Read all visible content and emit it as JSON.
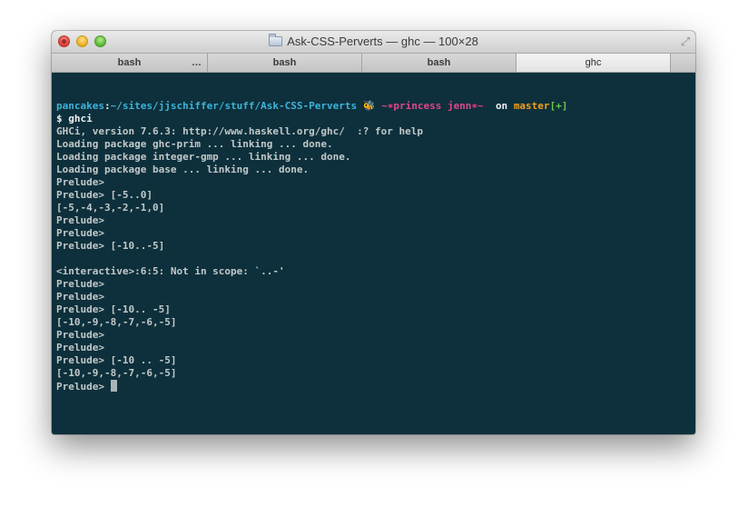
{
  "window": {
    "title": "Ask-CSS-Perverts — ghc — 100×28"
  },
  "tabs": [
    {
      "label": "bash",
      "extra": "…",
      "active": false
    },
    {
      "label": "bash",
      "extra": "",
      "active": false
    },
    {
      "label": "bash",
      "extra": "",
      "active": false
    },
    {
      "label": "ghc",
      "extra": "",
      "active": true
    }
  ],
  "prompt": {
    "user": "pancakes",
    "sep": ":",
    "path": "~/sites/jjschiffer/stuff/Ask-CSS-Perverts",
    "emoji": "🐝",
    "nickname": "~∗princess jenn∗~",
    "on": "on",
    "branch": "master",
    "status": "[+]"
  },
  "command": "$ ghci",
  "output": [
    "GHCi, version 7.6.3: http://www.haskell.org/ghc/  :? for help",
    "Loading package ghc-prim ... linking ... done.",
    "Loading package integer-gmp ... linking ... done.",
    "Loading package base ... linking ... done.",
    "Prelude>",
    "Prelude> [-5..0]",
    "[-5,-4,-3,-2,-1,0]",
    "Prelude>",
    "Prelude>",
    "Prelude> [-10..-5]",
    "",
    "<interactive>:6:5: Not in scope: `..-'",
    "Prelude>",
    "Prelude>",
    "Prelude> [-10.. -5]",
    "[-10,-9,-8,-7,-6,-5]",
    "Prelude>",
    "Prelude>",
    "Prelude> [-10 .. -5]",
    "[-10,-9,-8,-7,-6,-5]"
  ],
  "current_prompt": "Prelude> ",
  "colors": {
    "terminal_bg": "#0d303c",
    "text": "#c2c8c8",
    "path": "#3fb3d9",
    "nickname": "#e0468a",
    "branch": "#f0a020"
  }
}
